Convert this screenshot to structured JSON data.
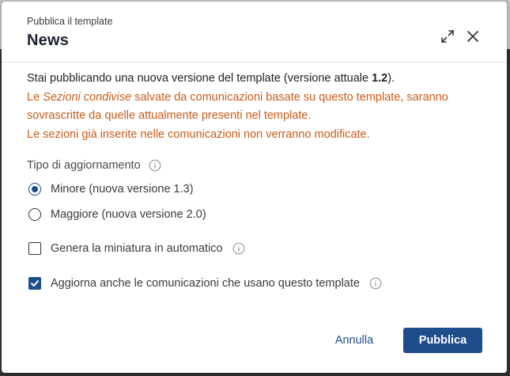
{
  "dialog": {
    "subtitle": "Pubblica il template",
    "title": "News",
    "expand_icon": "expand-icon",
    "close_icon": "close-icon"
  },
  "message": {
    "line1_prefix": "Stai pubblicando una nuova versione del template (versione attuale ",
    "line1_version": "1.2",
    "line1_suffix": ").",
    "warn_prefix": "Le ",
    "warn_emphasis": "Sezioni condivise",
    "warn_line1_rest": " salvate da comunicazioni basate su questo template, saranno",
    "warn_line2": "sovrascritte da quelle attualmente presenti nel template.",
    "warn_line3": "Le sezioni già inserite nelle comunicazioni non verranno modificate."
  },
  "update_type": {
    "label": "Tipo di aggiornamento",
    "options": [
      {
        "label": "Minore (nuova versione 1.3)",
        "selected": true
      },
      {
        "label": "Maggiore (nuova versione 2.0)",
        "selected": false
      }
    ]
  },
  "options": {
    "thumbnail": {
      "label": "Genera la miniatura in automatico",
      "checked": false
    },
    "update_comms": {
      "label": "Aggiorna anche le comunicazioni che usano questo template",
      "checked": true
    }
  },
  "footer": {
    "cancel_label": "Annulla",
    "publish_label": "Pubblica"
  },
  "colors": {
    "primary": "#1e4d8b",
    "warning": "#c95a16"
  }
}
